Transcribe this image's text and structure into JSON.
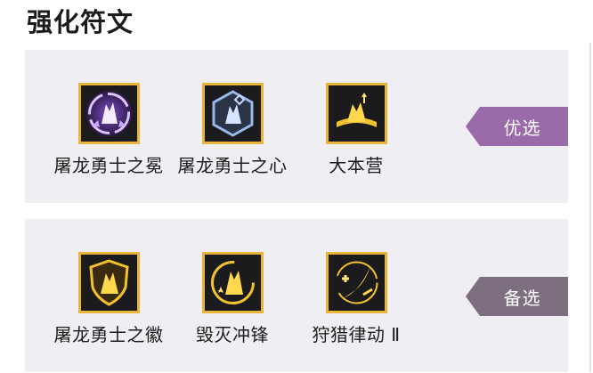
{
  "title": "强化符文",
  "sections": [
    {
      "tag": "优选",
      "tag_color": "#9b6aa9",
      "runes": [
        {
          "name": "屠龙勇士之冕",
          "icon": "dragon-slayer-crown-icon"
        },
        {
          "name": "屠龙勇士之心",
          "icon": "dragon-slayer-heart-icon"
        },
        {
          "name": "大本营",
          "icon": "base-camp-icon"
        }
      ]
    },
    {
      "tag": "备选",
      "tag_color": "#7d6e80",
      "runes": [
        {
          "name": "屠龙勇士之徽",
          "icon": "dragon-slayer-emblem-icon"
        },
        {
          "name": "毁灭冲锋",
          "icon": "destruction-charge-icon"
        },
        {
          "name": "狩猎律动 Ⅱ",
          "icon": "hunting-rhythm-icon"
        }
      ]
    }
  ],
  "colors": {
    "frame": "#e8b53a",
    "panel": "#efeff3",
    "icon_gold": "#f2c12e",
    "icon_purple": "#c9a6ff",
    "icon_blue": "#9ab8e8"
  }
}
